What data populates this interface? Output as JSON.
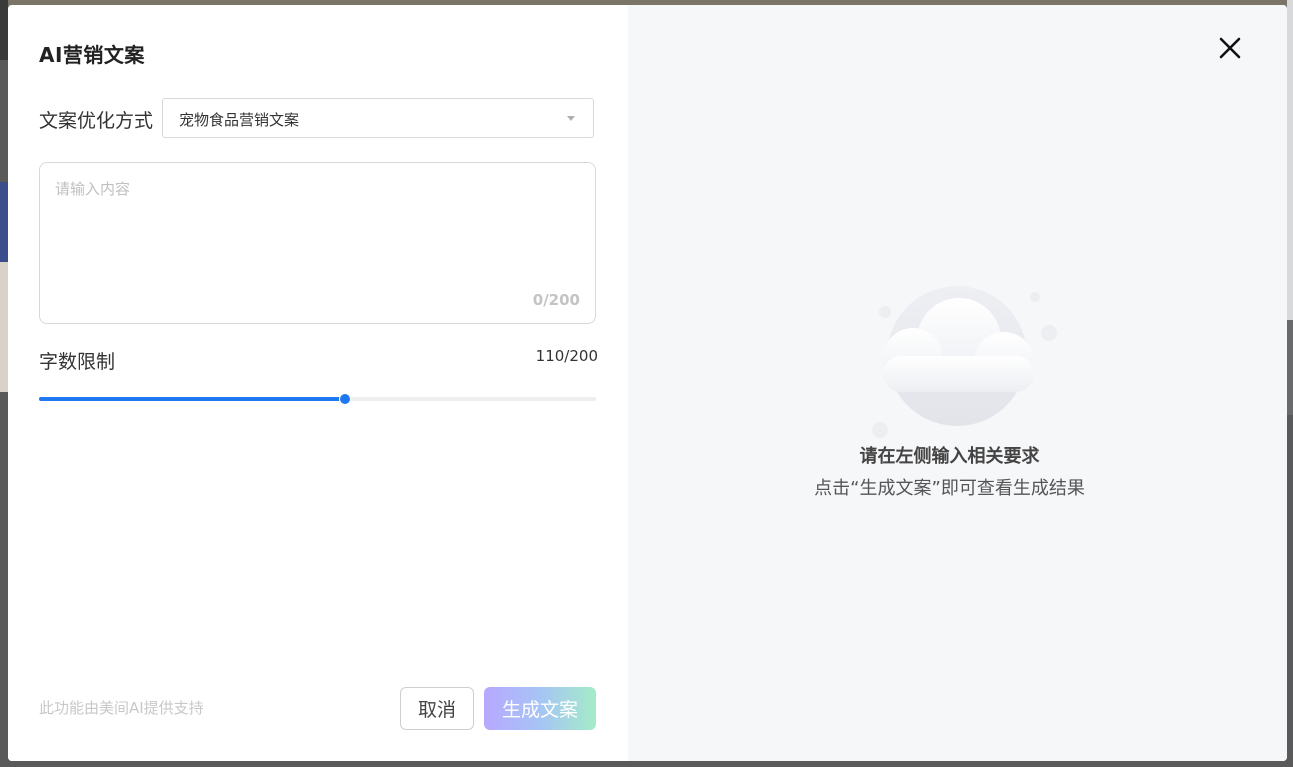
{
  "dialog": {
    "title": "AI营销文案",
    "close_icon": "close-icon"
  },
  "form": {
    "optimize_label": "文案优化方式",
    "optimize_select": {
      "value": "宠物食品营销文案",
      "caret_icon": "chevron-down-icon"
    },
    "content_input": {
      "placeholder": "请输入内容",
      "value": "",
      "counter": "0/200"
    },
    "word_limit": {
      "label": "字数限制",
      "value_text": "110/200",
      "value": 110,
      "max": 200
    }
  },
  "footer": {
    "powered_text": "此功能由美间AI提供支持",
    "cancel_label": "取消",
    "generate_label": "生成文案"
  },
  "result_panel": {
    "illustration_icon": "cloud-icon",
    "title": "请在左侧输入相关要求",
    "subtitle": "点击“生成文案”即可查看生成结果"
  },
  "colors": {
    "accent": "#1e78f0",
    "generate_gradient": [
      "#b7a8ff",
      "#a4ecc8"
    ],
    "right_panel_bg": "#f6f7f9"
  }
}
